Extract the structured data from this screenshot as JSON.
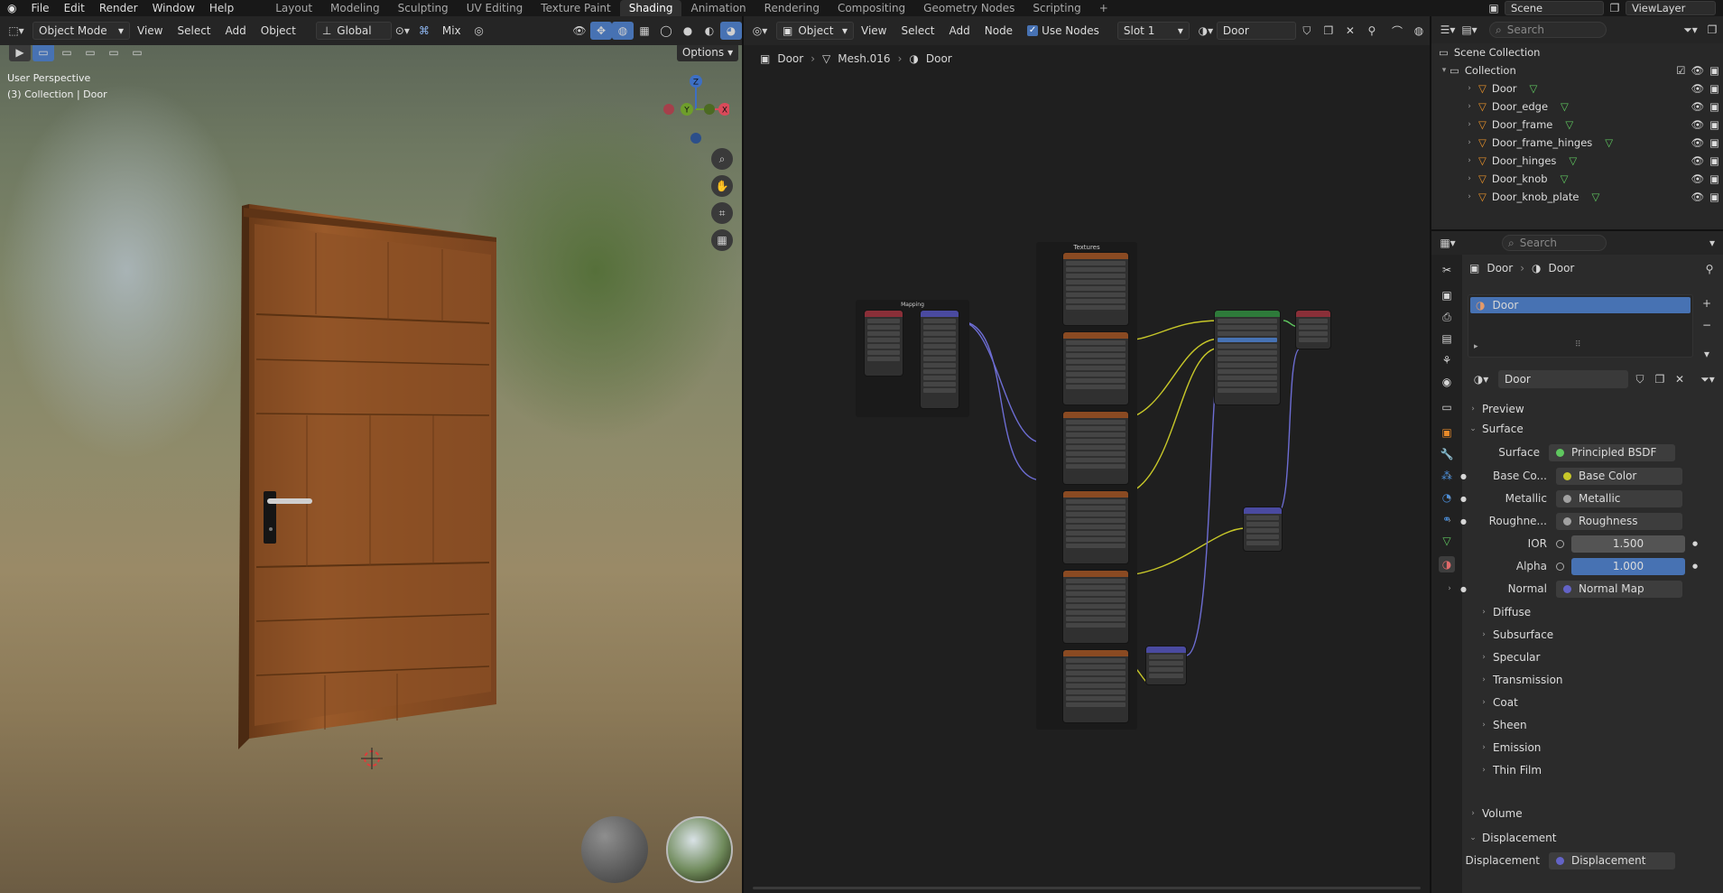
{
  "menubar": {
    "file": "File",
    "edit": "Edit",
    "render": "Render",
    "window": "Window",
    "help": "Help"
  },
  "workspaces": [
    "Layout",
    "Modeling",
    "Sculpting",
    "UV Editing",
    "Texture Paint",
    "Shading",
    "Animation",
    "Rendering",
    "Compositing",
    "Geometry Nodes",
    "Scripting"
  ],
  "active_workspace": "Shading",
  "scene": {
    "name": "Scene",
    "view_layer": "ViewLayer"
  },
  "viewport": {
    "mode": "Object Mode",
    "view": "View",
    "select": "Select",
    "add": "Add",
    "object": "Object",
    "orientation": "Global",
    "mix": "Mix",
    "options": "Options",
    "perspective_label": "User Perspective",
    "collection_label": "(3) Collection | Door",
    "gizmo": {
      "x": "X",
      "y": "Y",
      "z": "Z"
    }
  },
  "node_editor": {
    "type": "Object",
    "view": "View",
    "select": "Select",
    "add": "Add",
    "node": "Node",
    "use_nodes": "Use Nodes",
    "slot": "Slot 1",
    "material": "Door",
    "breadcrumb": [
      "Door",
      "Mesh.016",
      "Door"
    ],
    "frame_mapping": "Mapping",
    "frame_textures": "Textures"
  },
  "outliner": {
    "search_placeholder": "Search",
    "scene_collection": "Scene Collection",
    "collection": "Collection",
    "objects": [
      "Door",
      "Door_edge",
      "Door_frame",
      "Door_frame_hinges",
      "Door_hinges",
      "Door_knob",
      "Door_knob_plate"
    ]
  },
  "properties": {
    "search_placeholder": "Search",
    "breadcrumb_object": "Door",
    "breadcrumb_material": "Door",
    "material_slot": "Door",
    "material_name": "Door",
    "sections": {
      "preview": "Preview",
      "surface": "Surface",
      "volume": "Volume",
      "displacement": "Displacement"
    },
    "surface": {
      "label": "Surface",
      "value": "Principled BSDF"
    },
    "inputs": [
      {
        "label": "Base Co...",
        "value": "Base Color",
        "color": "#c7c729"
      },
      {
        "label": "Metallic",
        "value": "Metallic",
        "color": "#a1a1a1"
      },
      {
        "label": "Roughne...",
        "value": "Roughness",
        "color": "#a1a1a1"
      }
    ],
    "ior": {
      "label": "IOR",
      "value": "1.500"
    },
    "alpha": {
      "label": "Alpha",
      "value": "1.000"
    },
    "normal": {
      "label": "Normal",
      "value": "Normal Map",
      "color": "#6363c7"
    },
    "subpanels": [
      "Diffuse",
      "Subsurface",
      "Specular",
      "Transmission",
      "Coat",
      "Sheen",
      "Emission",
      "Thin Film"
    ],
    "displacement_field": {
      "label": "Displacement",
      "value": "Displacement",
      "color": "#6363c7"
    }
  },
  "colors": {
    "accent": "#4772b3",
    "active_tab": "#303030",
    "alpha_bar": "#4772b3"
  }
}
